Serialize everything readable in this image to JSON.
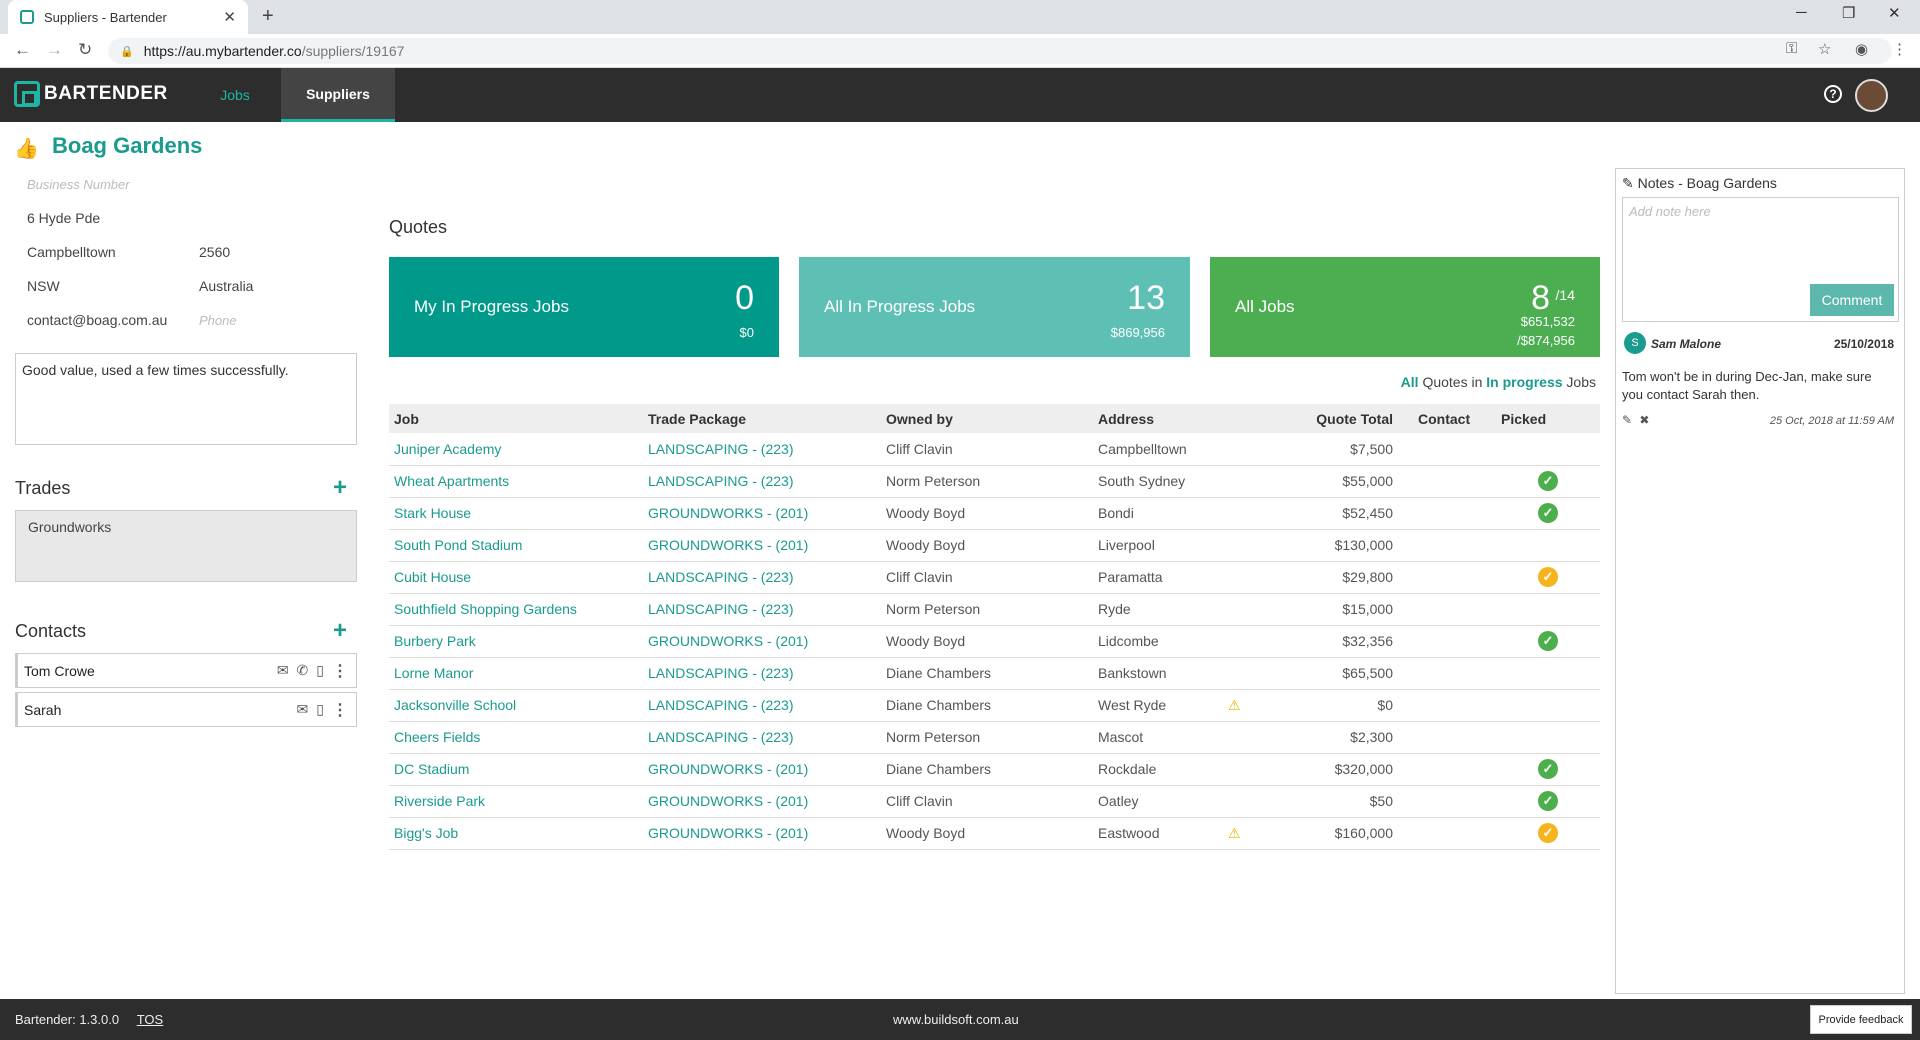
{
  "browser": {
    "tab_title": "Suppliers - Bartender",
    "url_host": "https://au.mybartender.co",
    "url_path": "/suppliers/19167"
  },
  "nav": {
    "logo": "BARTENDER",
    "jobs": "Jobs",
    "suppliers": "Suppliers",
    "help": "?"
  },
  "supplier": {
    "name": "Boag Gardens",
    "business_number_placeholder": "Business Number",
    "street": "6 Hyde Pde",
    "suburb": "Campbelltown",
    "postcode": "2560",
    "state": "NSW",
    "country": "Australia",
    "email": "contact@boag.com.au",
    "phone_placeholder": "Phone",
    "description": "Good value, used a few times successfully."
  },
  "trades": {
    "title": "Trades",
    "items": [
      "Groundworks"
    ]
  },
  "contacts": {
    "title": "Contacts",
    "items": [
      {
        "name": "Tom Crowe"
      },
      {
        "name": "Sarah"
      }
    ]
  },
  "quotes": {
    "title": "Quotes",
    "cards": [
      {
        "label": "My In Progress Jobs",
        "count": "0",
        "value": "$0",
        "color": "#00998a"
      },
      {
        "label": "All In Progress Jobs",
        "count": "13",
        "value": "$869,956",
        "color": "#5ec0b4"
      },
      {
        "label": "All Jobs",
        "count": "8",
        "count_total": "/14",
        "value": "$651,532",
        "value_total": "/$874,956",
        "color": "#4cae50"
      }
    ],
    "filter": {
      "all": "All",
      "quotes_in": "Quotes in",
      "in_progress": "In progress",
      "jobs": "Jobs"
    },
    "columns": [
      "Job",
      "Trade Package",
      "Owned by",
      "Address",
      "Quote Total",
      "Contact",
      "Picked"
    ],
    "rows": [
      {
        "job": "Juniper Academy",
        "pkg": "LANDSCAPING - (223)",
        "owner": "Cliff Clavin",
        "address": "Campbelltown",
        "warn": false,
        "total": "$7,500",
        "picked": ""
      },
      {
        "job": "Wheat Apartments",
        "pkg": "LANDSCAPING - (223)",
        "owner": "Norm Peterson",
        "address": "South Sydney",
        "warn": false,
        "total": "$55,000",
        "picked": "green"
      },
      {
        "job": "Stark House",
        "pkg": "GROUNDWORKS - (201)",
        "owner": "Woody Boyd",
        "address": "Bondi",
        "warn": false,
        "total": "$52,450",
        "picked": "green"
      },
      {
        "job": "South Pond Stadium",
        "pkg": "GROUNDWORKS - (201)",
        "owner": "Woody Boyd",
        "address": "Liverpool",
        "warn": false,
        "total": "$130,000",
        "picked": ""
      },
      {
        "job": "Cubit House",
        "pkg": "LANDSCAPING - (223)",
        "owner": "Cliff Clavin",
        "address": "Paramatta",
        "warn": false,
        "total": "$29,800",
        "picked": "yellow"
      },
      {
        "job": "Southfield Shopping Gardens",
        "pkg": "LANDSCAPING - (223)",
        "owner": "Norm Peterson",
        "address": "Ryde",
        "warn": false,
        "total": "$15,000",
        "picked": ""
      },
      {
        "job": "Burbery Park",
        "pkg": "GROUNDWORKS - (201)",
        "owner": "Woody Boyd",
        "address": "Lidcombe",
        "warn": false,
        "total": "$32,356",
        "picked": "green"
      },
      {
        "job": "Lorne Manor",
        "pkg": "LANDSCAPING - (223)",
        "owner": "Diane Chambers",
        "address": "Bankstown",
        "warn": false,
        "total": "$65,500",
        "picked": ""
      },
      {
        "job": "Jacksonville School",
        "pkg": "LANDSCAPING - (223)",
        "owner": "Diane Chambers",
        "address": "West Ryde",
        "warn": true,
        "total": "$0",
        "picked": ""
      },
      {
        "job": "Cheers Fields",
        "pkg": "LANDSCAPING - (223)",
        "owner": "Norm Peterson",
        "address": "Mascot",
        "warn": false,
        "total": "$2,300",
        "picked": ""
      },
      {
        "job": "DC Stadium",
        "pkg": "GROUNDWORKS - (201)",
        "owner": "Diane Chambers",
        "address": "Rockdale",
        "warn": false,
        "total": "$320,000",
        "picked": "green"
      },
      {
        "job": "Riverside Park",
        "pkg": "GROUNDWORKS - (201)",
        "owner": "Cliff Clavin",
        "address": "Oatley",
        "warn": false,
        "total": "$50",
        "picked": "green"
      },
      {
        "job": "Bigg's Job",
        "pkg": "GROUNDWORKS - (201)",
        "owner": "Woody Boyd",
        "address": "Eastwood",
        "warn": true,
        "total": "$160,000",
        "picked": "yellow"
      }
    ]
  },
  "notes": {
    "title": "Notes - Boag Gardens",
    "placeholder": "Add note here",
    "comment_button": "Comment",
    "items": [
      {
        "initial": "S",
        "author": "Sam Malone",
        "date": "25/10/2018",
        "text": "Tom won't be in during Dec-Jan, make sure you contact Sarah then.",
        "time": "25 Oct, 2018 at 11:59 AM"
      }
    ]
  },
  "footer": {
    "version": "Bartender: 1.3.0.0",
    "tos": "TOS",
    "site": "www.buildsoft.com.au",
    "feedback": "Provide feedback"
  }
}
